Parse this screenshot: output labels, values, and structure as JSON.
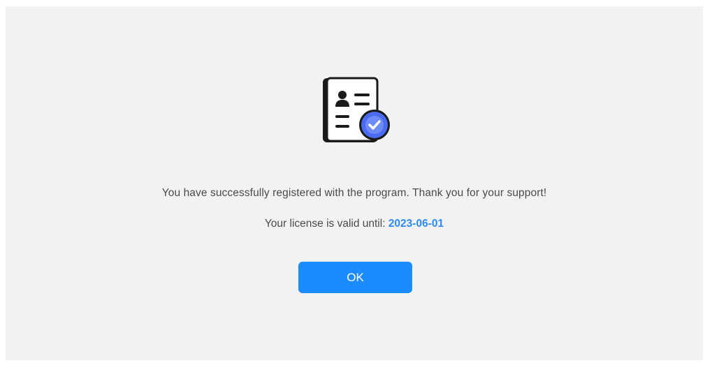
{
  "dialog": {
    "icon": "registration-card-check-icon",
    "message": "You have successfully registered with the program. Thank you for your support!",
    "license_prefix": "Your license is valid until: ",
    "license_date": "2023-06-01",
    "ok_label": "OK"
  },
  "colors": {
    "background": "#f2f2f2",
    "accent": "#1a8cff",
    "date_text": "#2e8af7",
    "check_badge": "#4a6cf0"
  }
}
